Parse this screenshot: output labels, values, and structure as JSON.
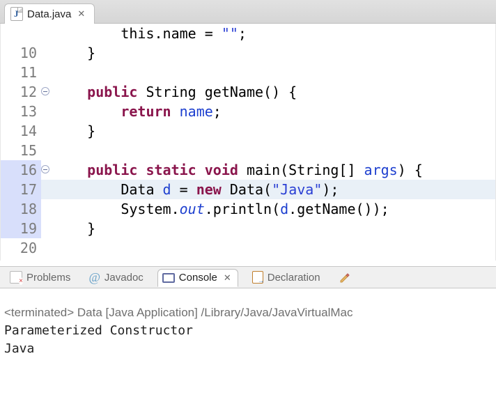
{
  "editor": {
    "tab": {
      "title": "Data.java"
    },
    "lines": [
      {
        "n": " ",
        "fold": false,
        "blue": false,
        "hl": false,
        "tokens": [
          [
            "        ",
            ""
          ],
          [
            "this",
            ""
          ],
          [
            ".name = ",
            ""
          ],
          [
            "\"\"",
            "str"
          ],
          [
            ";",
            ""
          ]
        ]
      },
      {
        "n": "10",
        "fold": false,
        "blue": false,
        "hl": false,
        "tokens": [
          [
            "    }",
            ""
          ]
        ]
      },
      {
        "n": "11",
        "fold": false,
        "blue": false,
        "hl": false,
        "tokens": [
          [
            "",
            ""
          ]
        ]
      },
      {
        "n": "12",
        "fold": true,
        "blue": false,
        "hl": false,
        "tokens": [
          [
            "    ",
            ""
          ],
          [
            "public ",
            "kw"
          ],
          [
            "String ",
            ""
          ],
          [
            "getName() {",
            ""
          ]
        ]
      },
      {
        "n": "13",
        "fold": false,
        "blue": false,
        "hl": false,
        "tokens": [
          [
            "        ",
            ""
          ],
          [
            "return ",
            "kw"
          ],
          [
            "name",
            "field"
          ],
          [
            ";",
            ""
          ]
        ]
      },
      {
        "n": "14",
        "fold": false,
        "blue": false,
        "hl": false,
        "tokens": [
          [
            "    }",
            ""
          ]
        ]
      },
      {
        "n": "15",
        "fold": false,
        "blue": false,
        "hl": false,
        "tokens": [
          [
            "",
            ""
          ]
        ]
      },
      {
        "n": "16",
        "fold": true,
        "blue": true,
        "hl": false,
        "tokens": [
          [
            "    ",
            ""
          ],
          [
            "public static void ",
            "kw"
          ],
          [
            "main(String[] ",
            ""
          ],
          [
            "args",
            "field"
          ],
          [
            ") {",
            ""
          ]
        ]
      },
      {
        "n": "17",
        "fold": false,
        "blue": true,
        "hl": true,
        "tokens": [
          [
            "        Data ",
            ""
          ],
          [
            "d",
            "field"
          ],
          [
            " = ",
            ""
          ],
          [
            "new ",
            "kw"
          ],
          [
            "Data(",
            ""
          ],
          [
            "\"Java\"",
            "str"
          ],
          [
            ");",
            ""
          ]
        ]
      },
      {
        "n": "18",
        "fold": false,
        "blue": true,
        "hl": false,
        "tokens": [
          [
            "        System.",
            ""
          ],
          [
            "out",
            "fieldit"
          ],
          [
            ".println(",
            ""
          ],
          [
            "d",
            "field"
          ],
          [
            ".getName());",
            ""
          ]
        ]
      },
      {
        "n": "19",
        "fold": false,
        "blue": true,
        "hl": false,
        "tokens": [
          [
            "    }",
            ""
          ]
        ]
      },
      {
        "n": "20",
        "fold": false,
        "blue": false,
        "hl": false,
        "tokens": [
          [
            "",
            ""
          ]
        ]
      }
    ]
  },
  "bottom_tabs": {
    "problems": "Problems",
    "javadoc": "Javadoc",
    "console": "Console",
    "declaration": "Declaration"
  },
  "console": {
    "status": "<terminated> Data [Java Application] /Library/Java/JavaVirtualMac",
    "out": [
      "Parameterized Constructor",
      "Java"
    ]
  }
}
